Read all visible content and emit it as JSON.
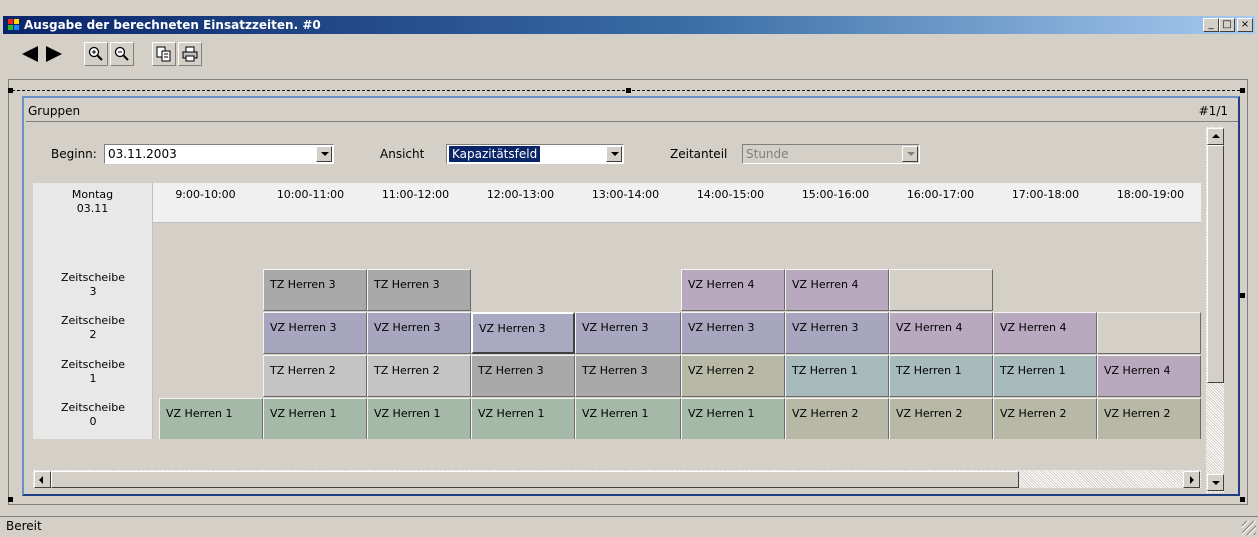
{
  "window": {
    "title": "Ausgabe der berechneten Einsatzzeiten. #0",
    "controls": {
      "minimize": "_",
      "maximize": "□",
      "close": "×"
    }
  },
  "toolbar": {
    "buttons": [
      {
        "name": "back",
        "icon": "arrow-left-icon"
      },
      {
        "name": "forward",
        "icon": "arrow-right-icon"
      },
      {
        "name": "zoom-in",
        "icon": "zoom-in-icon"
      },
      {
        "name": "zoom-out",
        "icon": "zoom-out-icon"
      },
      {
        "name": "copy",
        "icon": "copy-icon"
      },
      {
        "name": "print",
        "icon": "print-icon"
      }
    ]
  },
  "panel": {
    "title": "Gruppen",
    "page_indicator": "#1/1"
  },
  "filters": {
    "begin_label": "Beginn:",
    "begin_value": "03.11.2003",
    "view_label": "Ansicht",
    "view_value": "Kapazitätsfeld",
    "share_label": "Zeitanteil",
    "share_value": "Stunde"
  },
  "grid": {
    "day_name": "Montag",
    "day_date": "03.11",
    "hours": [
      "9:00-10:00",
      "10:00-11:00",
      "11:00-12:00",
      "12:00-13:00",
      "13:00-14:00",
      "14:00-15:00",
      "15:00-16:00",
      "16:00-17:00",
      "17:00-18:00",
      "18:00-19:00"
    ],
    "rows": [
      {
        "label": "Zeitscheibe",
        "index": "3"
      },
      {
        "label": "Zeitscheibe",
        "index": "2"
      },
      {
        "label": "Zeitscheibe",
        "index": "1"
      },
      {
        "label": "Zeitscheibe",
        "index": "0"
      }
    ],
    "cells": {
      "r3": [
        "",
        "TZ Herren 3",
        "TZ Herren 3",
        "",
        "",
        "VZ Herren 4",
        "VZ Herren 4",
        "",
        "",
        ""
      ],
      "r2": [
        "",
        "VZ Herren 3",
        "VZ Herren 3",
        "VZ Herren 3",
        "VZ Herren 3",
        "VZ Herren 3",
        "VZ Herren 3",
        "VZ Herren 4",
        "VZ Herren 4",
        ""
      ],
      "r1": [
        "",
        "TZ Herren 2",
        "TZ Herren 2",
        "TZ Herren 3",
        "TZ Herren 3",
        "VZ Herren 2",
        "TZ Herren 1",
        "TZ Herren 1",
        "TZ Herren 1",
        "VZ Herren 4"
      ],
      "r0": [
        "VZ Herren 1",
        "VZ Herren 1",
        "VZ Herren 1",
        "VZ Herren 1",
        "VZ Herren 1",
        "VZ Herren 1",
        "VZ Herren 2",
        "VZ Herren 2",
        "VZ Herren 2",
        "VZ Herren 2"
      ]
    }
  },
  "status": {
    "text": "Bereit"
  }
}
